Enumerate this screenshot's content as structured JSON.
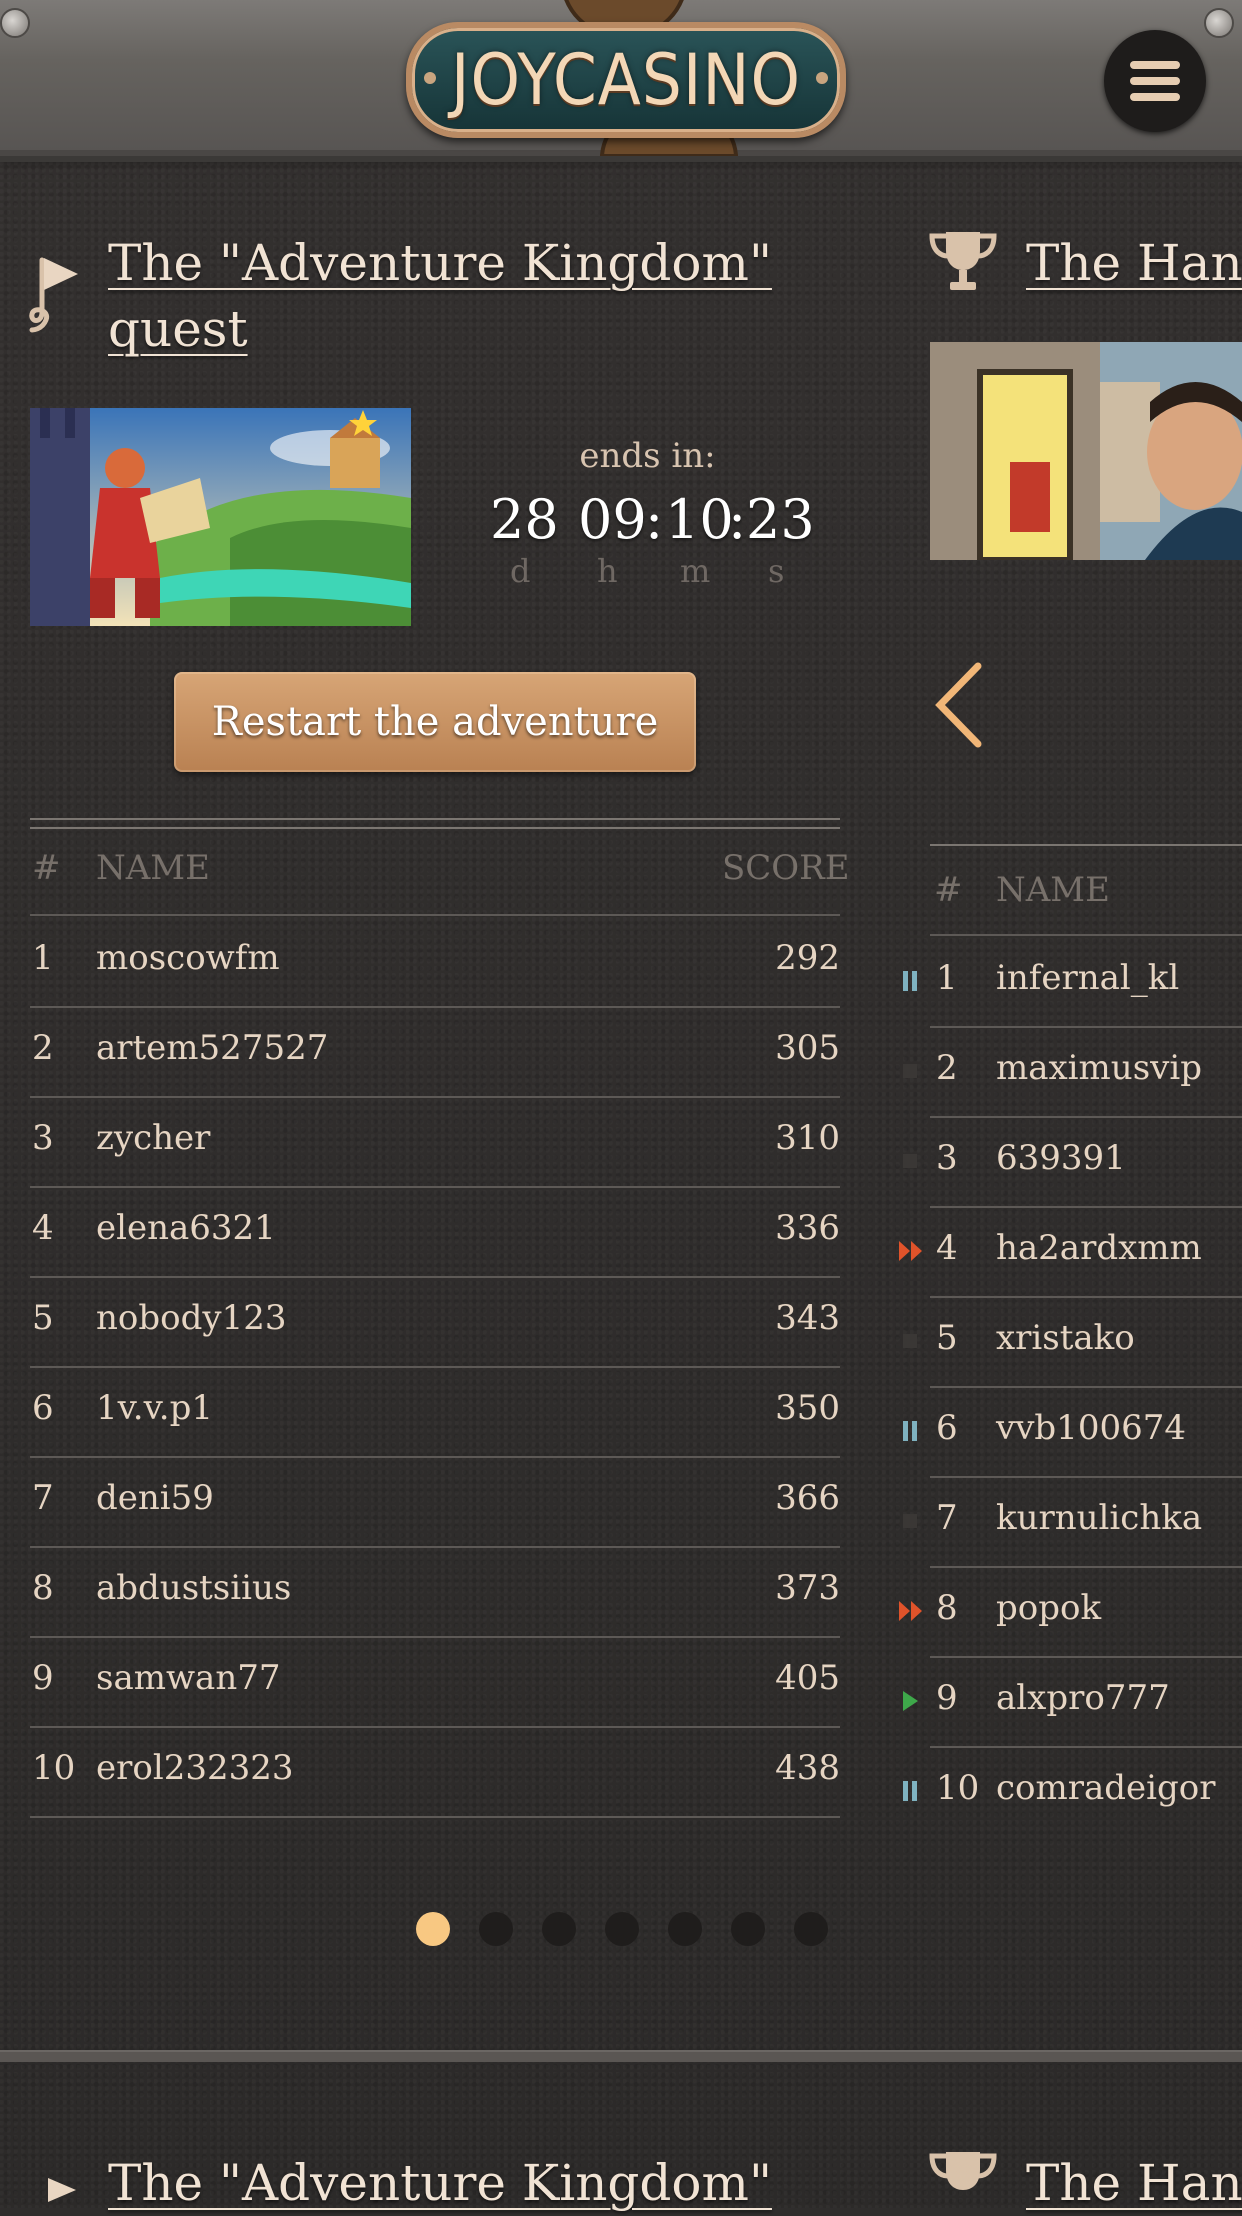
{
  "header": {
    "logo_text": "JOYCASINO",
    "menu_icon": "hamburger-icon"
  },
  "left_card": {
    "title_line1": "The \"Adventure Kingdom\"",
    "title_line2": "quest",
    "icon": "flag-icon",
    "ends_in_label": "ends in:",
    "timer": {
      "d": "28",
      "h": "09",
      "m": "10",
      "s": "23",
      "sep": ":"
    },
    "timer_units": {
      "d": "d",
      "h": "h",
      "m": "m",
      "s": "s"
    },
    "restart_button": "Restart the adventure",
    "columns": {
      "rank": "#",
      "name": "NAME",
      "score": "SCORE"
    },
    "rows": [
      {
        "rank": "1",
        "name": "moscowfm",
        "score": "292"
      },
      {
        "rank": "2",
        "name": "artem527527",
        "score": "305"
      },
      {
        "rank": "3",
        "name": "zycher",
        "score": "310"
      },
      {
        "rank": "4",
        "name": "elena6321",
        "score": "336"
      },
      {
        "rank": "5",
        "name": "nobody123",
        "score": "343"
      },
      {
        "rank": "6",
        "name": "1v.v.p1",
        "score": "350"
      },
      {
        "rank": "7",
        "name": "deni59",
        "score": "366"
      },
      {
        "rank": "8",
        "name": "abdustsiius",
        "score": "373"
      },
      {
        "rank": "9",
        "name": "samwan77",
        "score": "405"
      },
      {
        "rank": "10",
        "name": "erol232323",
        "score": "438"
      }
    ]
  },
  "right_card": {
    "title": "The Hand",
    "icon": "trophy-icon",
    "back_icon": "chevron-left-icon",
    "columns": {
      "rank": "#",
      "name": "NAME"
    },
    "rows": [
      {
        "rank": "1",
        "name": "infernal_kl",
        "status": "pause"
      },
      {
        "rank": "2",
        "name": "maximusvip",
        "status": "stop"
      },
      {
        "rank": "3",
        "name": "639391",
        "status": "stop"
      },
      {
        "rank": "4",
        "name": "ha2ardxmm",
        "status": "fast-forward"
      },
      {
        "rank": "5",
        "name": "xristako",
        "status": "stop"
      },
      {
        "rank": "6",
        "name": "vvb100674",
        "status": "pause"
      },
      {
        "rank": "7",
        "name": "kurnulichka",
        "status": "stop"
      },
      {
        "rank": "8",
        "name": "popok",
        "status": "fast-forward"
      },
      {
        "rank": "9",
        "name": "alxpro777",
        "status": "play"
      },
      {
        "rank": "10",
        "name": "comradeigor",
        "status": "pause"
      }
    ]
  },
  "carousel": {
    "pages": 7,
    "active_index": 0
  },
  "next_section": {
    "left_title": "The \"Adventure Kingdom\"",
    "right_title": "The Hand"
  },
  "colors": {
    "accent": "#f8c882",
    "button": "#c8915f",
    "status_pause": "#7fb2c0",
    "status_ff": "#e0532a",
    "status_play": "#3ea84a",
    "status_stop": "#3a3735"
  }
}
